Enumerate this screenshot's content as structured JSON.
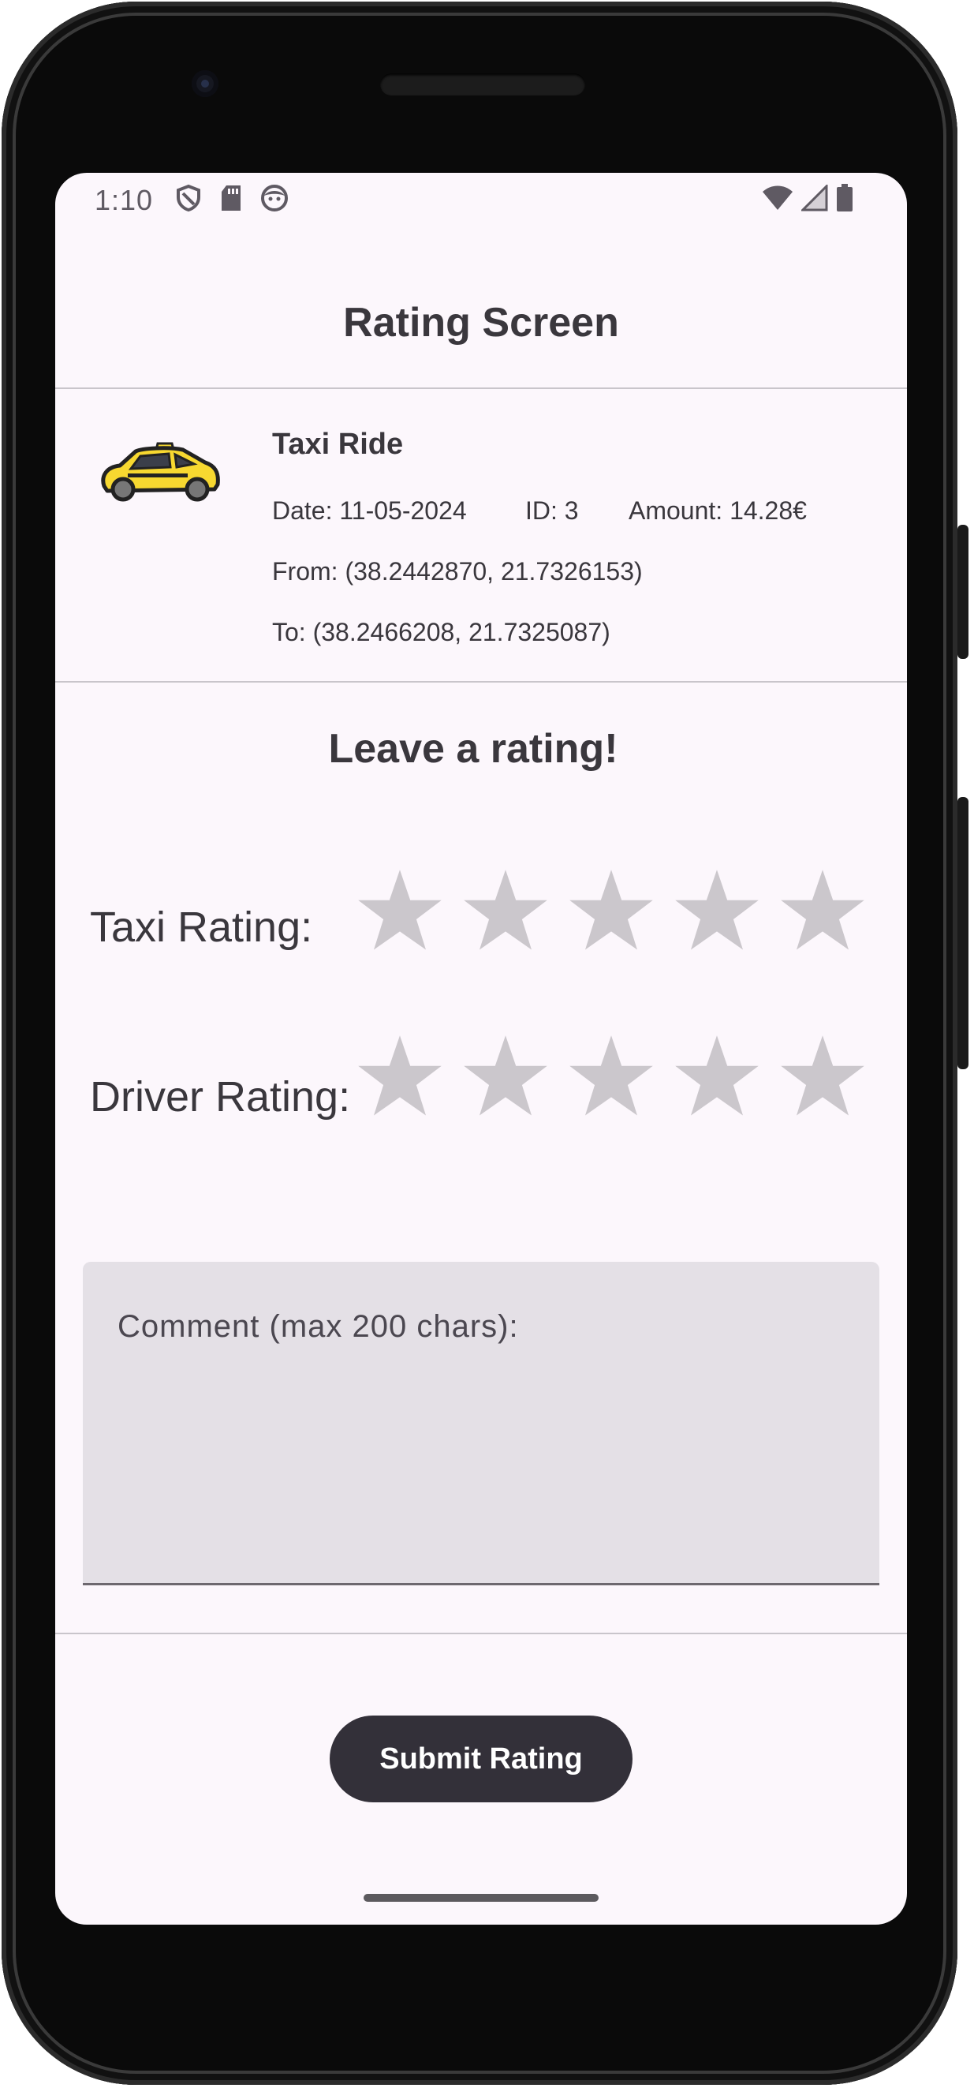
{
  "status_bar": {
    "time": "1:10",
    "left_icons": [
      "shield-icon",
      "sd-card-icon",
      "face-icon"
    ],
    "right_icons": [
      "wifi-icon",
      "cell-signal-icon",
      "battery-icon"
    ]
  },
  "header": {
    "title": "Rating Screen"
  },
  "ride": {
    "icon": "taxi-car-icon",
    "title": "Taxi Ride",
    "date": "Date: 11-05-2024",
    "id": "ID: 3",
    "amount": "Amount: 14.28€",
    "from": "From: (38.2442870, 21.7326153)",
    "to": "To: (38.2466208, 21.7325087)"
  },
  "rating": {
    "heading": "Leave a rating!",
    "taxi_label": "Taxi Rating:",
    "driver_label": "Driver Rating:",
    "taxi_value": 0,
    "driver_value": 0,
    "max_stars": 5
  },
  "comment": {
    "placeholder": "Comment (max 200 chars):",
    "value": ""
  },
  "submit": {
    "label": "Submit Rating"
  },
  "colors": {
    "screen_bg": "#fcf7fc",
    "text": "#3a373d",
    "star_empty": "#cbc7cc",
    "button_bg": "#333039",
    "comment_bg": "#e4e0e6",
    "taxi_yellow": "#f7d830"
  }
}
